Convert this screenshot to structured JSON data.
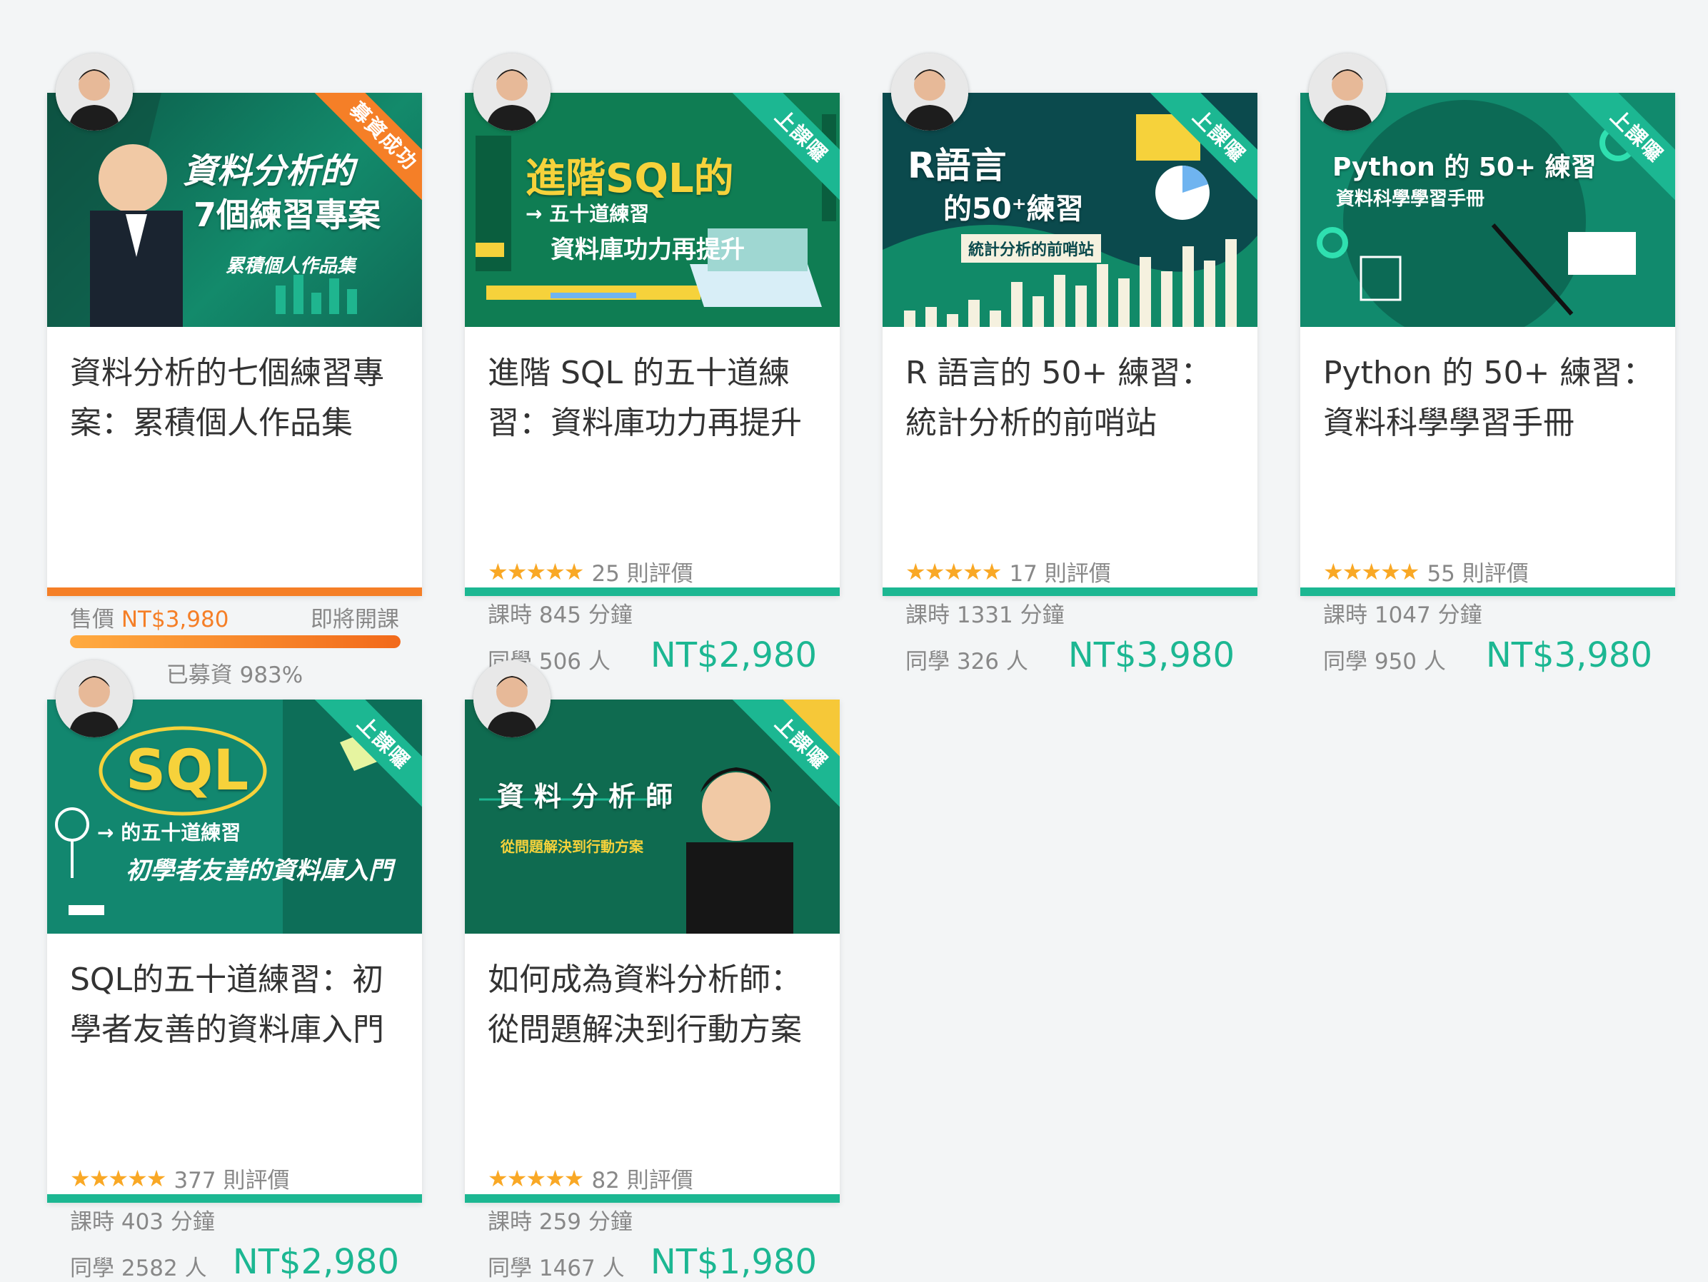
{
  "colors": {
    "accent": "#1cb792",
    "funding": "#f57f27",
    "star": "#f9a825",
    "muted": "#888888"
  },
  "icons": {
    "star": "★",
    "avatar": "instructor-avatar"
  },
  "courses": [
    {
      "id": "c1",
      "ribbon": "募資成功",
      "thumb_title": "資料分析的",
      "thumb_title2": "7個練習專案",
      "thumb_sub": "累積個人作品集",
      "title": "資料分析的七個練習專案：累積個人作品集",
      "funding": {
        "price_label": "售價",
        "price": "NT$3,980",
        "status": "即將開課",
        "percent_text": "已募資 983%",
        "progress": 1.0
      }
    },
    {
      "id": "c2",
      "ribbon": "上課囉",
      "thumb_title": "進階SQL的",
      "thumb_title2": "→ 五十道練習",
      "thumb_sub": "資料庫功力再提升",
      "title": "進階 SQL 的五十道練習：資料庫功力再提升",
      "rating": "25 則評價",
      "duration": "課時 845 分鐘",
      "students": "同學 506 人",
      "price": "NT$2,980"
    },
    {
      "id": "c3",
      "ribbon": "上課囉",
      "thumb_title": "R語言",
      "thumb_title2": "的50⁺練習",
      "thumb_sub": "統計分析的前哨站",
      "title": "R 語言的 50+ 練習：統計分析的前哨站",
      "rating": "17 則評價",
      "duration": "課時 1331 分鐘",
      "students": "同學 326 人",
      "price": "NT$3,980"
    },
    {
      "id": "c4",
      "ribbon": "上課囉",
      "thumb_title": "Python 的 50+ 練習",
      "thumb_title2": "",
      "thumb_sub": "資料科學學習手冊",
      "title": "Python 的 50+ 練習：資料科學學習手冊",
      "rating": "55 則評價",
      "duration": "課時 1047 分鐘",
      "students": "同學 950 人",
      "price": "NT$3,980"
    },
    {
      "id": "c5",
      "ribbon": "上課囉",
      "thumb_title": "SQL",
      "thumb_title2": "→ 的五十道練習",
      "thumb_sub": "初學者友善的資料庫入門",
      "title": "SQL的五十道練習：初學者友善的資料庫入門",
      "rating": "377 則評價",
      "duration": "課時 403 分鐘",
      "students": "同學 2582 人",
      "price": "NT$2,980"
    },
    {
      "id": "c6",
      "ribbon": "上課囉",
      "thumb_title": "資料分析師",
      "thumb_title2": "",
      "thumb_sub": "從問題解決到行動方案",
      "title": "如何成為資料分析師：從問題解決到行動方案",
      "rating": "82 則評價",
      "duration": "課時 259 分鐘",
      "students": "同學 1467 人",
      "price": "NT$1,980"
    }
  ]
}
